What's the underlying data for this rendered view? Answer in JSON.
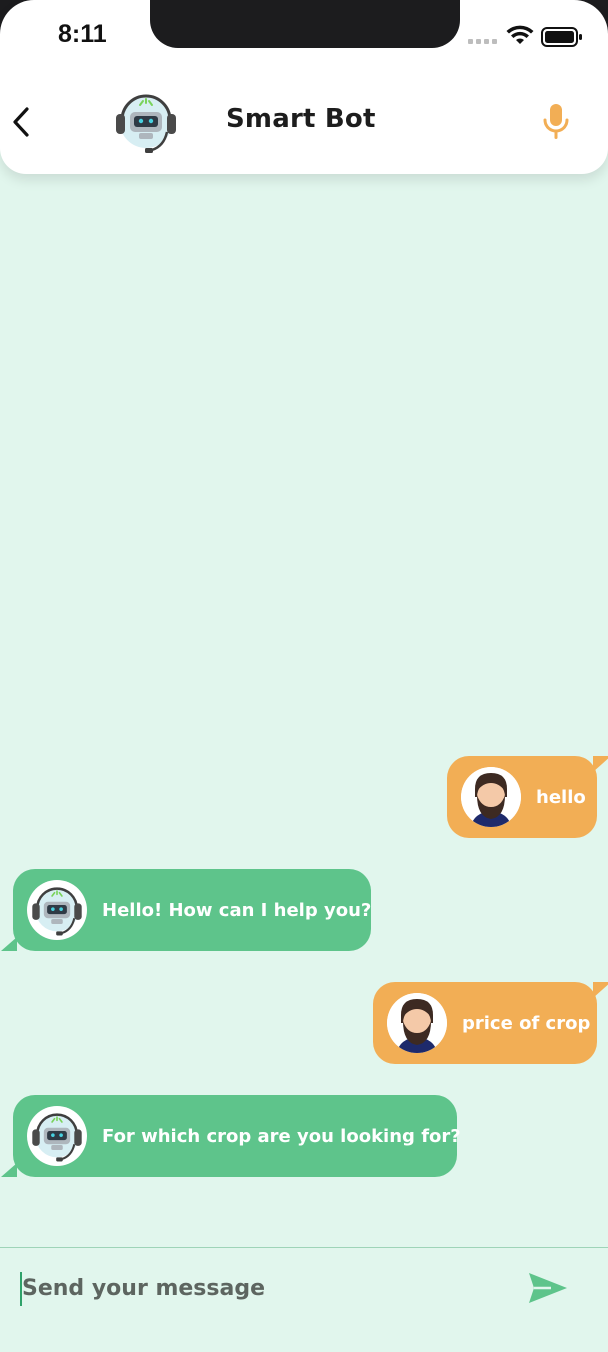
{
  "status_bar": {
    "time": "8:11"
  },
  "header": {
    "title": "Smart Bot"
  },
  "messages": [
    {
      "sender": "user",
      "text": "hello"
    },
    {
      "sender": "bot",
      "text": "Hello! How can I help you?"
    },
    {
      "sender": "user",
      "text": "price of crop"
    },
    {
      "sender": "bot",
      "text": "For which crop are you looking for?"
    }
  ],
  "input": {
    "placeholder": "Send your message",
    "value": ""
  },
  "colors": {
    "background": "#e1f6ed",
    "user_bubble": "#f2ae55",
    "bot_bubble": "#5ec48b",
    "mic_accent": "#f2ae55",
    "send_accent": "#5ec48b"
  },
  "icons": {
    "back": "chevron-left-icon",
    "mic": "microphone-icon",
    "send": "send-icon",
    "wifi": "wifi-icon",
    "battery": "battery-icon"
  }
}
